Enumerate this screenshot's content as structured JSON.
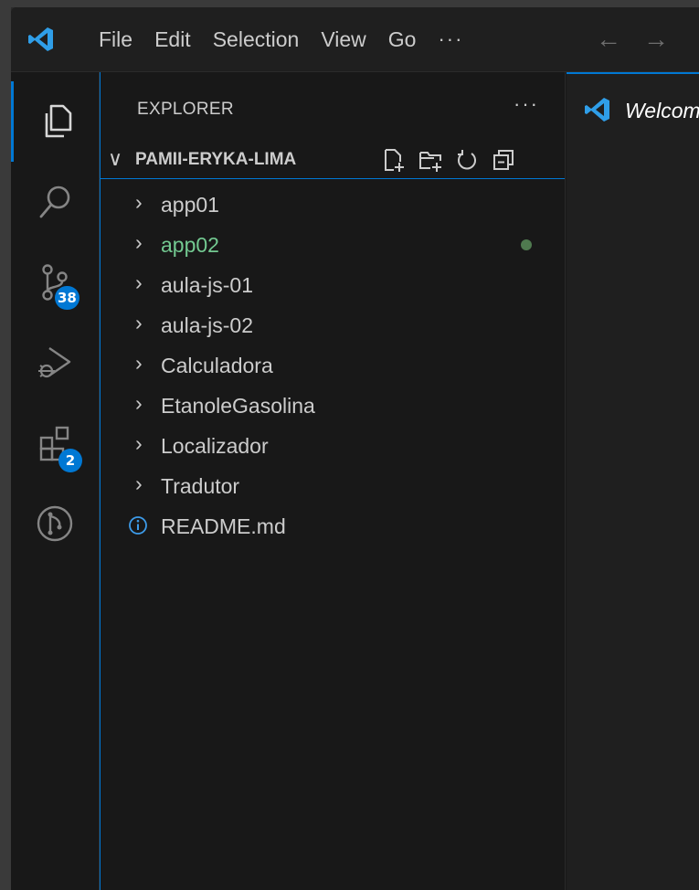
{
  "titlebar": {
    "menu": [
      "File",
      "Edit",
      "Selection",
      "View",
      "Go"
    ],
    "more": "···",
    "back_arrow": "←",
    "forward_arrow": "→"
  },
  "activitybar": {
    "items": [
      {
        "icon": "files-icon",
        "active": true
      },
      {
        "icon": "search-icon"
      },
      {
        "icon": "source-control-icon",
        "badge": "38"
      },
      {
        "icon": "run-debug-icon"
      },
      {
        "icon": "extensions-icon",
        "badge": "2"
      },
      {
        "icon": "git-graph-icon"
      }
    ]
  },
  "sidebar": {
    "title": "EXPLORER",
    "more": "···",
    "section": {
      "chevron": "∨",
      "label": "PAMII-ERYKA-LIMA"
    },
    "items": [
      {
        "label": "app01",
        "type": "folder"
      },
      {
        "label": "app02",
        "type": "folder",
        "modified": true
      },
      {
        "label": "aula-js-01",
        "type": "folder"
      },
      {
        "label": "aula-js-02",
        "type": "folder"
      },
      {
        "label": "Calculadora",
        "type": "folder"
      },
      {
        "label": "EtanoleGasolina",
        "type": "folder"
      },
      {
        "label": "Localizador",
        "type": "folder"
      },
      {
        "label": "Tradutor",
        "type": "folder"
      },
      {
        "label": "README.md",
        "type": "file"
      }
    ],
    "chevron": "›"
  },
  "editor": {
    "tab_label": "Welcom"
  },
  "colors": {
    "accent": "#0078d4",
    "modified": "#73c991",
    "vscode_blue": "#2f9ee8"
  }
}
